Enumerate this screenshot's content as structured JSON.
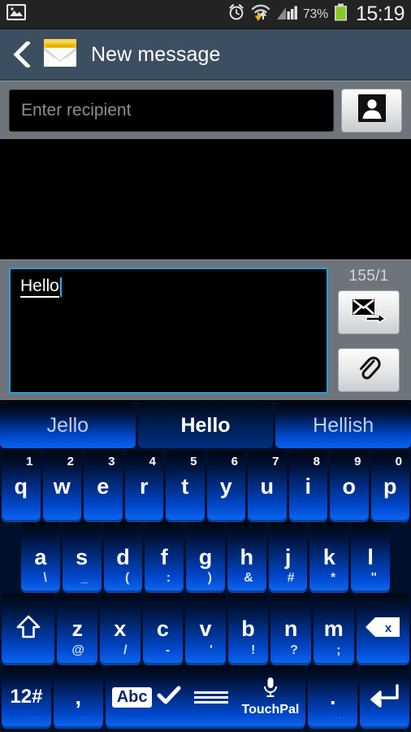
{
  "statusbar": {
    "left_icons": [
      "image-icon"
    ],
    "right_icons": [
      "alarm-icon",
      "wifi-transfer-icon",
      "signal-icon"
    ],
    "battery_percent": "73%",
    "clock": "15:19"
  },
  "titlebar": {
    "back_icon": "back-chevron-icon",
    "app_icon": "envelope-icon",
    "title": "New message"
  },
  "recipient": {
    "placeholder": "Enter recipient",
    "value": "",
    "contacts_button_icon": "contact-person-icon"
  },
  "compose": {
    "message": "Hello",
    "char_count": "155/1",
    "send_button_icon": "send-envelope-icon",
    "attach_button_icon": "paperclip-icon"
  },
  "keyboard": {
    "suggestions": [
      {
        "label": "Jello",
        "active": false
      },
      {
        "label": "Hello",
        "active": true
      },
      {
        "label": "Hellish",
        "active": false
      }
    ],
    "row1": [
      {
        "glyph": "q",
        "num": "1"
      },
      {
        "glyph": "w",
        "num": "2"
      },
      {
        "glyph": "e",
        "num": "3"
      },
      {
        "glyph": "r",
        "num": "4"
      },
      {
        "glyph": "t",
        "num": "5"
      },
      {
        "glyph": "y",
        "num": "6"
      },
      {
        "glyph": "u",
        "num": "7"
      },
      {
        "glyph": "i",
        "num": "8"
      },
      {
        "glyph": "o",
        "num": "9"
      },
      {
        "glyph": "p",
        "num": "0"
      }
    ],
    "row2": [
      {
        "glyph": "a",
        "alt": "\\"
      },
      {
        "glyph": "s",
        "alt": "_"
      },
      {
        "glyph": "d",
        "alt": "("
      },
      {
        "glyph": "f",
        "alt": ":"
      },
      {
        "glyph": "g",
        "alt": ")"
      },
      {
        "glyph": "h",
        "alt": "&"
      },
      {
        "glyph": "j",
        "alt": "#"
      },
      {
        "glyph": "k",
        "alt": "*"
      },
      {
        "glyph": "l",
        "alt": "\""
      }
    ],
    "row3": [
      {
        "glyph": "z",
        "alt": "@"
      },
      {
        "glyph": "x",
        "alt": "/"
      },
      {
        "glyph": "c",
        "alt": "-"
      },
      {
        "glyph": "v",
        "alt": "'"
      },
      {
        "glyph": "b",
        "alt": "!"
      },
      {
        "glyph": "n",
        "alt": "?"
      },
      {
        "glyph": "m",
        "alt": ";"
      }
    ],
    "shift_key_icon": "shift-arrow-icon",
    "backspace_key_icon": "backspace-icon",
    "symbols_key_label": "12#",
    "comma_key_label": ",",
    "period_key_label": ".",
    "space_abc_label": "Abc",
    "space_check_icon": "checkmark-icon",
    "mic_icon": "microphone-icon",
    "ime_label": "TouchPal",
    "enter_key_icon": "enter-arrow-icon",
    "more_dots": "..."
  },
  "colors": {
    "titlebar_bg": "#3c4f60",
    "panel_bg": "#6d747b",
    "focus_border": "#20a2d8",
    "key_blue": "#0048cd",
    "status_bg": "#232323",
    "battery_green": "#8bc722"
  }
}
